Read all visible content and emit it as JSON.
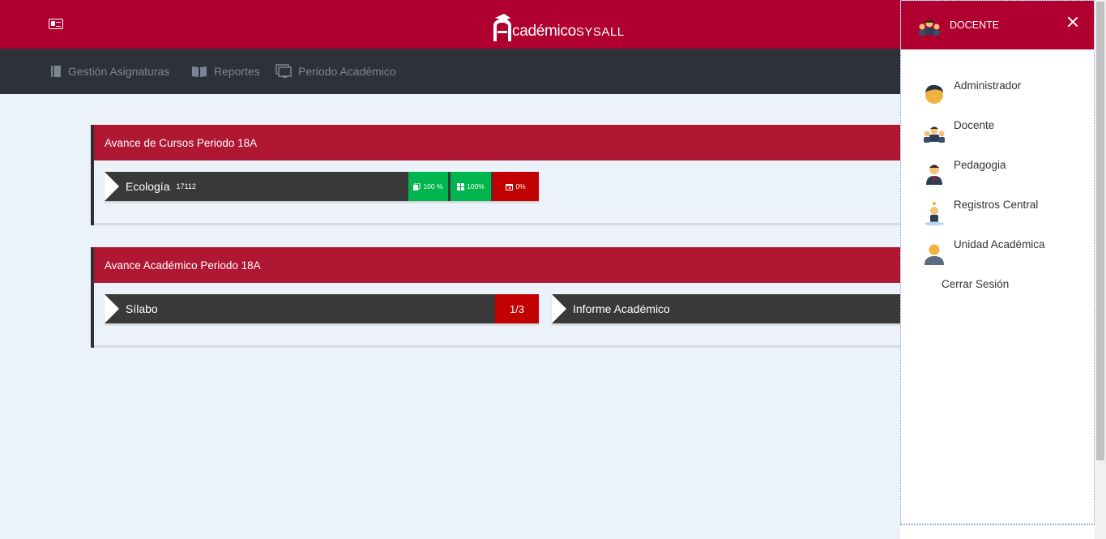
{
  "header": {
    "logo_brand": "cadémico",
    "logo_suffix": "SYSALL"
  },
  "nav": {
    "items": [
      {
        "label": "Gestión Asignaturas",
        "icon": "book-icon"
      },
      {
        "label": "Reportes",
        "icon": "open-book-icon"
      },
      {
        "label": "Periodo Académico",
        "icon": "monitor-icon"
      }
    ]
  },
  "courses_panel": {
    "title": "Avance de Cursos Periodo 18A",
    "course": {
      "name": "Ecología",
      "code": "17112",
      "stat1": "100 %",
      "stat2": "100%",
      "stat3": "0%"
    }
  },
  "academic_panel": {
    "title": "Avance Académico Periodo 18A",
    "silabo_label": "Sílabo",
    "silabo_count": "1/3",
    "informe_label": "Informe Académico"
  },
  "drawer": {
    "title": "DOCENTE",
    "items": [
      {
        "label": "Administrador",
        "icon": "administrator-avatar-icon"
      },
      {
        "label": "Docente",
        "icon": "teachers-group-icon"
      },
      {
        "label": "Pedagogia",
        "icon": "pedagogy-avatar-icon"
      },
      {
        "label": "Registros Central",
        "icon": "registry-avatar-icon"
      },
      {
        "label": "Unidad Académica",
        "icon": "academic-unit-avatar-icon"
      }
    ],
    "logout_label": "Cerrar Sesión"
  },
  "colors": {
    "brand_red": "#b0002f",
    "panel_red": "#b01733",
    "dark_nav": "#2d3239",
    "bar_dark": "#393939",
    "success_green": "#00b44e",
    "alert_red": "#c20000",
    "background": "#ecf2f9"
  }
}
